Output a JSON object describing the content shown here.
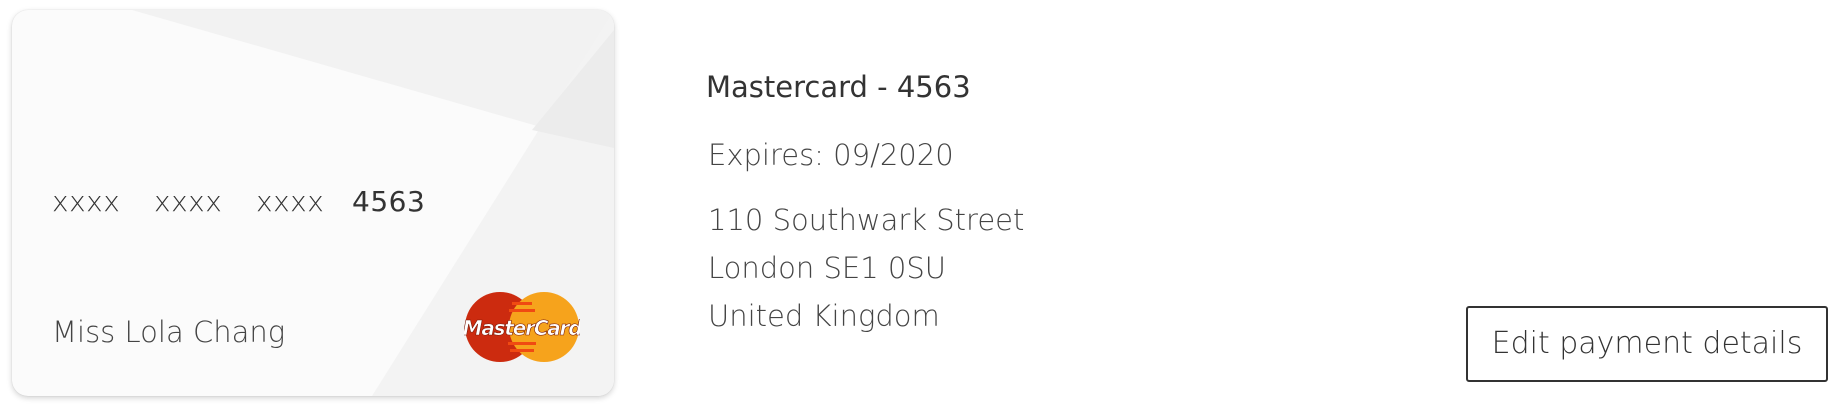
{
  "card": {
    "number_groups": [
      "xxxx",
      "xxxx",
      "xxxx",
      "4563"
    ],
    "holder_name": "Miss Lola Chang",
    "brand_logo_text": "MasterCard",
    "brand_colors": {
      "red": "#cc2b0f",
      "orange": "#f6a31c",
      "card_background": "#fbfbfb"
    }
  },
  "details": {
    "title": "Mastercard - 4563",
    "expiry": "Expires: 09/2020",
    "address": [
      "110 Southwark Street",
      "London SE1 0SU",
      "United Kingdom"
    ]
  },
  "actions": {
    "edit_label": "Edit payment details"
  }
}
